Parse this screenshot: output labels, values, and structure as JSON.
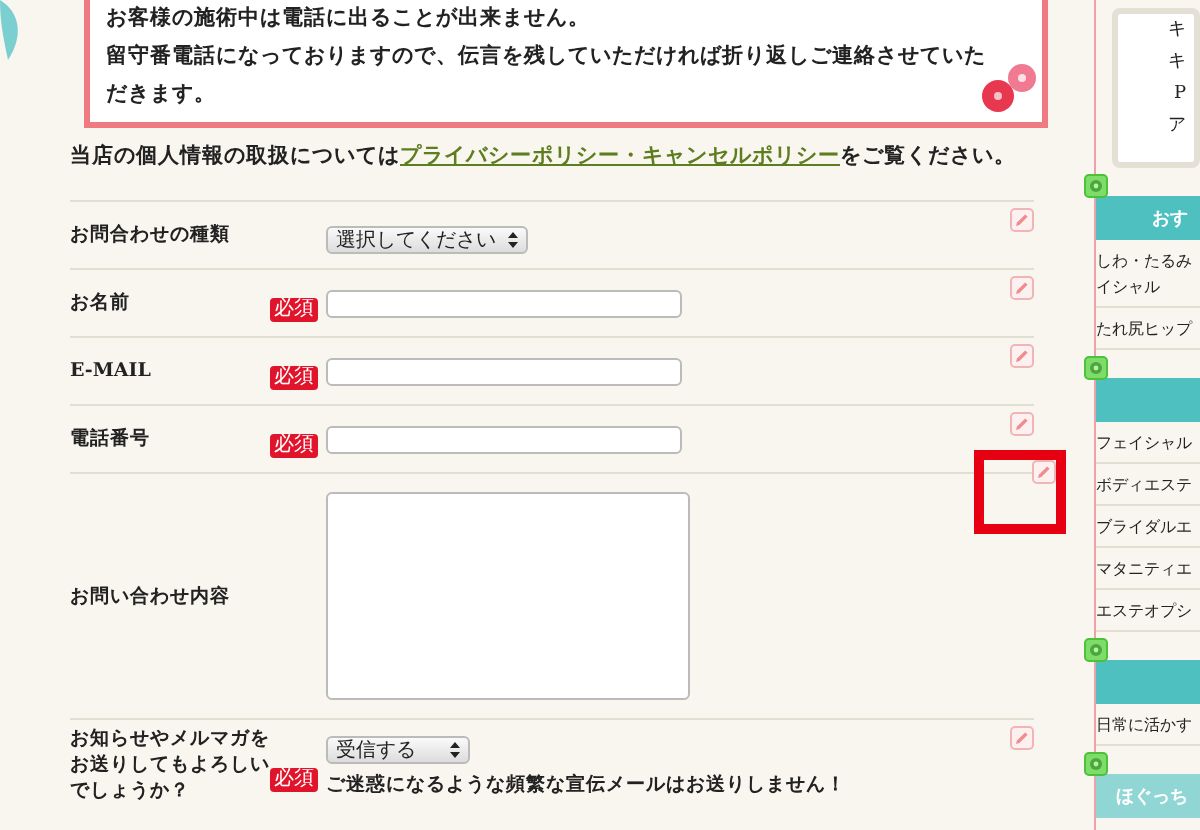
{
  "notice": {
    "lines": [
      "お客様の施術中は電話に出ることが出来ません。",
      "留守番電話になっておりますので、伝言を残していただければ折り返しご連絡させていただきます。"
    ]
  },
  "policy": {
    "before": "当店の個人情報の取扱については",
    "link": "プライバシーポリシー・キャンセルポリシー",
    "after": "をご覧ください。"
  },
  "form": {
    "rows": [
      {
        "label": "お問合わせの種類",
        "required": false,
        "kind": "select",
        "value": "選択してください",
        "highlighted": false
      },
      {
        "label": "お名前",
        "required": true,
        "badge": "必須",
        "kind": "text",
        "highlighted": false
      },
      {
        "label": "E-MAIL",
        "required": true,
        "badge": "必須",
        "kind": "text",
        "highlighted": false
      },
      {
        "label": "電話番号",
        "required": true,
        "badge": "必須",
        "kind": "text",
        "highlighted": false
      },
      {
        "label": "お問い合わせ内容",
        "required": false,
        "kind": "textarea",
        "highlighted": true
      },
      {
        "label": "お知らせやメルマガをお送りしてもよろしいでしょうか？",
        "required": true,
        "badge": "必須",
        "kind": "select",
        "value": "受信する",
        "note": "ご迷惑になるような頻繁な宣伝メールはお送りしません！",
        "highlighted": false
      }
    ]
  },
  "sidebar": {
    "card_lines": [
      "キ",
      "キ",
      "P",
      "ア"
    ],
    "sections": [
      {
        "title": "おす",
        "items": [
          [
            "しわ・たるみ",
            "イシャル"
          ],
          [
            "たれ尻ヒップ"
          ]
        ]
      },
      {
        "items": [
          [
            "フェイシャル"
          ],
          [
            "ボディエステ"
          ],
          [
            "ブライダルエ"
          ],
          [
            "マタニティエ"
          ],
          [
            "エステオプシ"
          ]
        ]
      },
      {
        "items": [
          [
            "日常に活かす"
          ]
        ]
      },
      {
        "title": "ほぐっち"
      }
    ]
  }
}
